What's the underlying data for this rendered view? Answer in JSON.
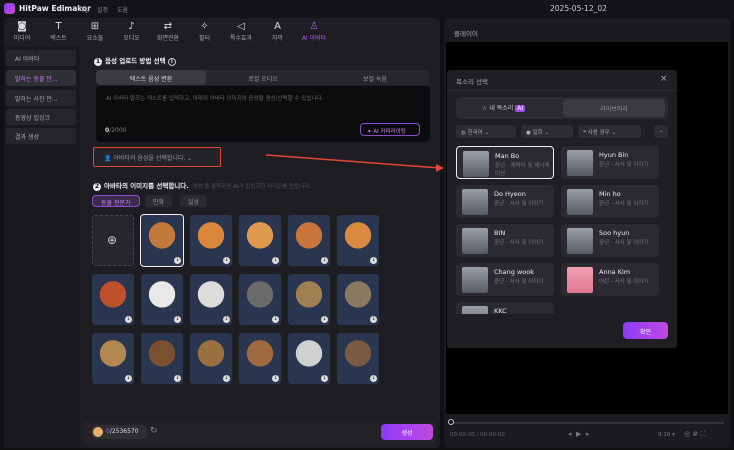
{
  "app": {
    "name": "HitPaw Edimakor",
    "menus": [
      "파일",
      "설정",
      "도움"
    ],
    "project_title": "2025-05-12_02"
  },
  "toolbar": [
    {
      "label": "미디어",
      "icon": "media-icon"
    },
    {
      "label": "텍스트",
      "icon": "text-icon"
    },
    {
      "label": "요소들",
      "icon": "elements-icon"
    },
    {
      "label": "오디오",
      "icon": "audio-icon"
    },
    {
      "label": "화면전환",
      "icon": "transition-icon"
    },
    {
      "label": "필터",
      "icon": "filter-icon"
    },
    {
      "label": "특수효과",
      "icon": "effects-icon"
    },
    {
      "label": "자막",
      "icon": "subtitle-icon"
    },
    {
      "label": "AI 아바타",
      "icon": "avatar-icon",
      "active": true
    }
  ],
  "sidebar": [
    "AI 아바타",
    "말하는 동물 만...",
    "말하는 사진 만...",
    "동영상 립싱크",
    "결과 생성"
  ],
  "step1": {
    "num": "1",
    "title": "음성 업로드 방법 선택",
    "tabs": [
      "텍스트 음성 변환",
      "로컬 오디오",
      "보컬 녹음"
    ],
    "placeholder": "AI 아바타 말하는 텍스트를 입력하고, 아래의 아바타 이미지와 음성을 생성/선택할 수 있습니다.",
    "count": "0",
    "max": "/2000",
    "ai_btn": "AI 카피라이팅",
    "voice_select": "아바타의 음성을 선택합니다."
  },
  "step2": {
    "num": "2",
    "title": "아바타의 이미지를 선택합니다.",
    "hint": "'생성'을 클릭하면 AI가 립싱크한 비디오를 만듭니다.",
    "categories": [
      "동물 전문가",
      "만화",
      "일상"
    ]
  },
  "avatars": [
    "cat",
    "fox",
    "cat",
    "fox",
    "fox",
    "panda-red",
    "panda",
    "panda",
    "raccoon",
    "kangaroo",
    "cat-suit",
    "cheetah",
    "bear",
    "lion",
    "dog",
    "panda",
    "beaver"
  ],
  "footer": {
    "credits_used": "0",
    "credits_total": "/2536570",
    "generate": "생성"
  },
  "player": {
    "title": "플레이어",
    "time": "00:00:00",
    "duration": "/ 00:00:00",
    "ratio": "9:16"
  },
  "dialog": {
    "title": "목소리 선택",
    "tab_mine": "내 목소리",
    "ai_badge": "AI",
    "tab_library": "라이브러리",
    "filters": [
      "한국어",
      "일회",
      "사용 경우"
    ],
    "voices": [
      {
        "name": "Man Bo",
        "desc": "중년 - 캐릭터 및 애니메이션"
      },
      {
        "name": "Hyun Bin",
        "desc": "중년 - 서사 및 이야기"
      },
      {
        "name": "Do Hyeon",
        "desc": "중년 - 서사 및 이야기"
      },
      {
        "name": "Min ho",
        "desc": "중년 - 서사 및 이야기"
      },
      {
        "name": "BIN",
        "desc": "중년 - 서사 및 이야기"
      },
      {
        "name": "Soo hyun",
        "desc": "중년 - 서사 및 이야기"
      },
      {
        "name": "Chang wook",
        "desc": "중년 - 서사 및 이야기"
      },
      {
        "name": "Anna Kim",
        "desc": "어린 - 서사 및 이야기"
      },
      {
        "name": "KKC",
        "desc": ""
      }
    ],
    "confirm": "확인"
  },
  "colors": {
    "accent": "#b15cf5",
    "highlight": "#e0483a"
  }
}
